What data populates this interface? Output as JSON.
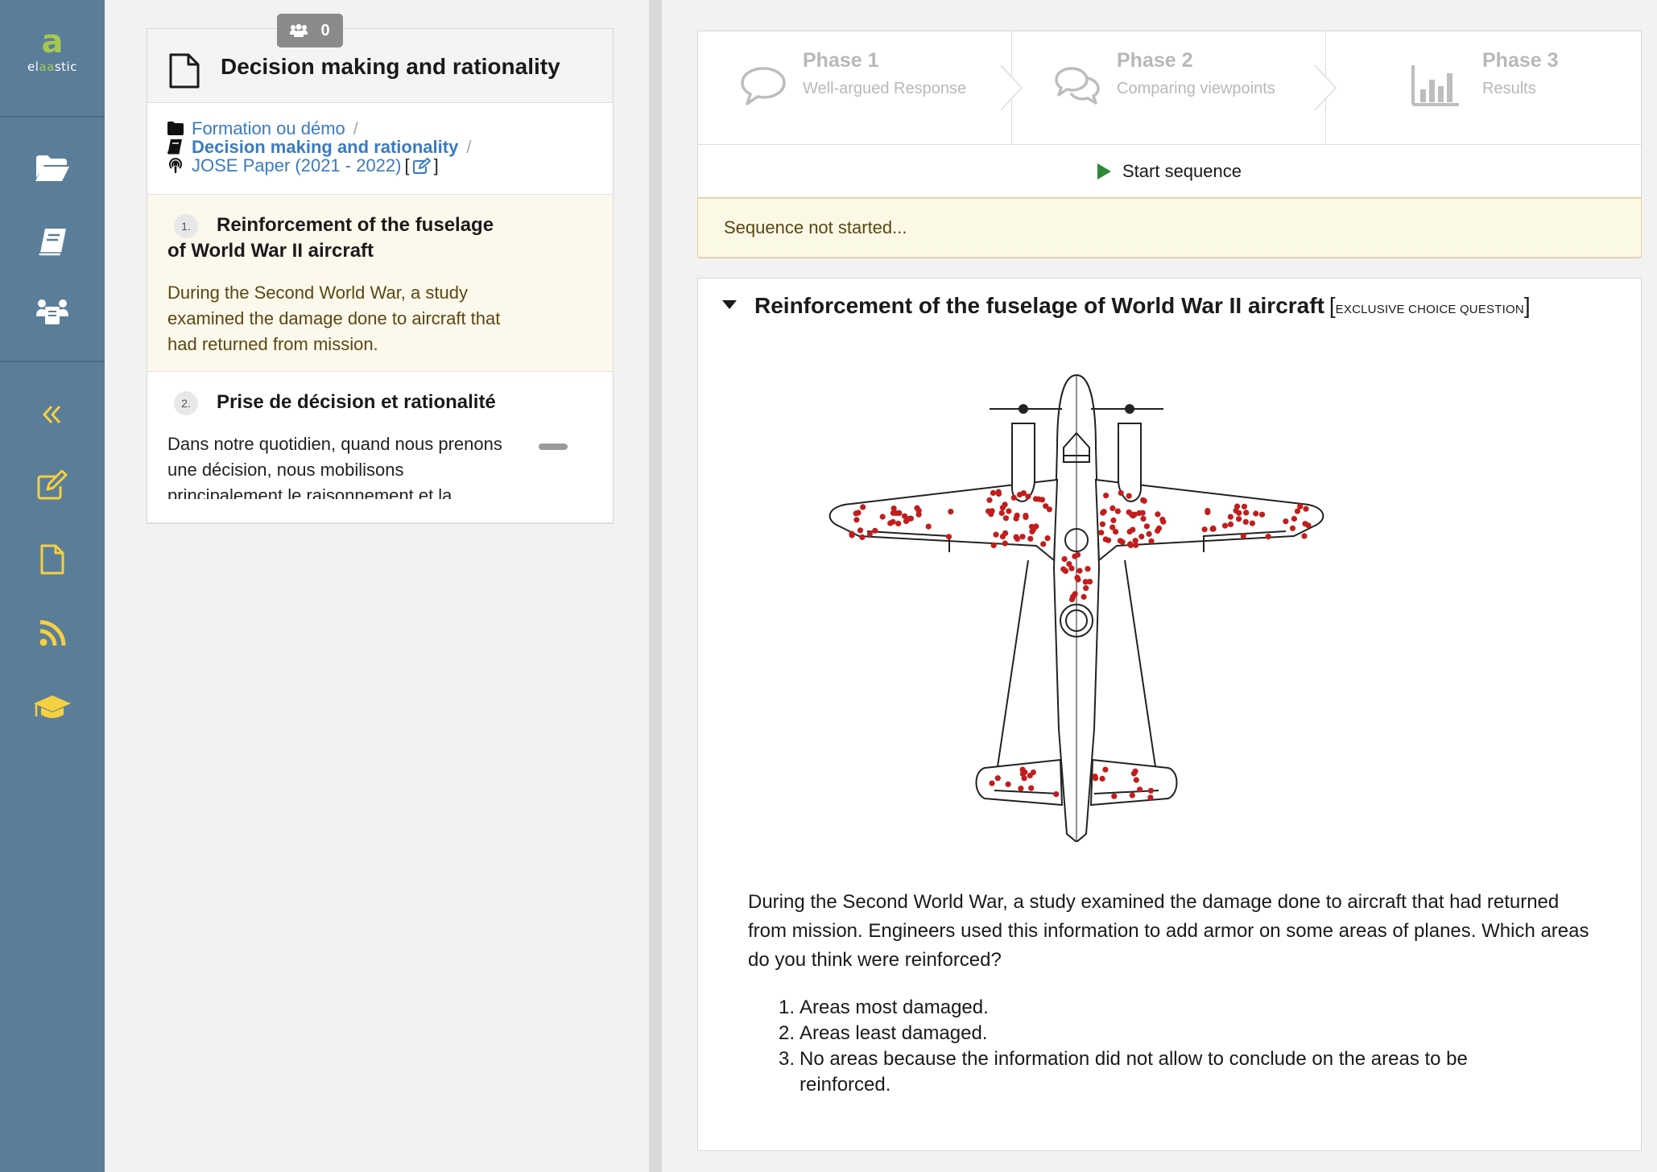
{
  "app": {
    "logo_mark": "a",
    "logo_text_prefix": "el",
    "logo_text_accent": "aa",
    "logo_text_suffix": "stic",
    "colors": {
      "sidebar": "#5a7d99",
      "accent": "#f5d040",
      "logo_green": "#a5c852",
      "link": "#3a7bc2"
    },
    "nav_icons": [
      "folder-open-icon",
      "book-icon",
      "users-icon",
      "double-chevron-left-icon",
      "edit-icon",
      "document-icon",
      "rss-icon",
      "graduation-cap-icon"
    ]
  },
  "sequence_panel": {
    "participants_count": "0",
    "title": "Decision making and rationality",
    "breadcrumb": {
      "course": "Formation ou démo",
      "sep1": "/",
      "subject": "Decision making and rationality",
      "sep2": "/",
      "session": "JOSE Paper (2021 - 2022)",
      "bracket_open": "[",
      "bracket_close": "]"
    },
    "statements": [
      {
        "number": "1.",
        "title": "Reinforcement of the fuselage of World War II aircraft",
        "excerpt": "During the Second World War, a study examined the damage done to aircraft that had returned from mission."
      },
      {
        "number": "2.",
        "title": "Prise de décision et rationalité",
        "excerpt": "Dans notre quotidien, quand nous prenons une décision, nous mobilisons principalement le raisonnement et la"
      }
    ]
  },
  "phases": [
    {
      "name": "Phase 1",
      "subtitle": "Well-argued Response",
      "icon": "comment-icon"
    },
    {
      "name": "Phase 2",
      "subtitle": "Comparing viewpoints",
      "icon": "comments-icon"
    },
    {
      "name": "Phase 3",
      "subtitle": "Results",
      "icon": "bar-chart-icon"
    }
  ],
  "controls": {
    "start_label": "Start sequence",
    "status": "Sequence not started..."
  },
  "question": {
    "title": "Reinforcement of the fuselage of World War II aircraft",
    "type_open": "[",
    "type_label": "Exclusive choice question",
    "type_close": "]",
    "text": "During the Second World War, a study examined the damage done to aircraft that had returned from mission. Engineers used this information to add armor on some areas of planes. Which areas do you think were reinforced?",
    "options": [
      {
        "n": "1.",
        "label": "Areas most damaged."
      },
      {
        "n": "2.",
        "label": "Areas least damaged."
      },
      {
        "n": "3.",
        "label": "No areas because the information did not allow to conclude on the areas to be reinforced."
      }
    ]
  }
}
